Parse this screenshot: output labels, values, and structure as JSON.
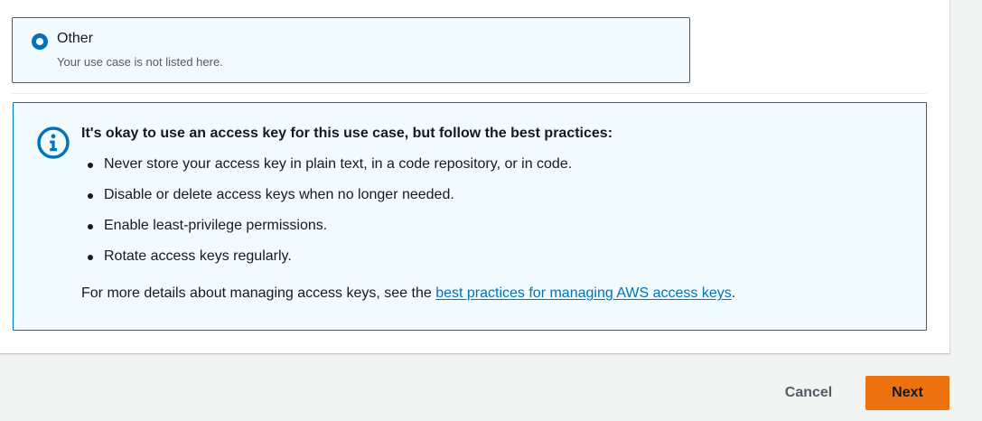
{
  "option": {
    "label": "Other",
    "description": "Your use case is not listed here.",
    "selected": true
  },
  "info": {
    "icon": "info-circle-icon",
    "title": "It's okay to use an access key for this use case, but follow the best practices:",
    "bullets": [
      "Never store your access key in plain text, in a code repository, or in code.",
      "Disable or delete access keys when no longer needed.",
      "Enable least-privilege permissions.",
      "Rotate access keys regularly."
    ],
    "more_prefix": "For more details about managing access keys, see the ",
    "more_link": "best practices for managing AWS access keys",
    "more_suffix": "."
  },
  "actions": {
    "cancel_label": "Cancel",
    "next_label": "Next"
  },
  "colors": {
    "accent_blue": "#0073bb",
    "info_background": "#f1faff",
    "primary_button": "#ec7211",
    "page_background": "#f2f3f3"
  }
}
